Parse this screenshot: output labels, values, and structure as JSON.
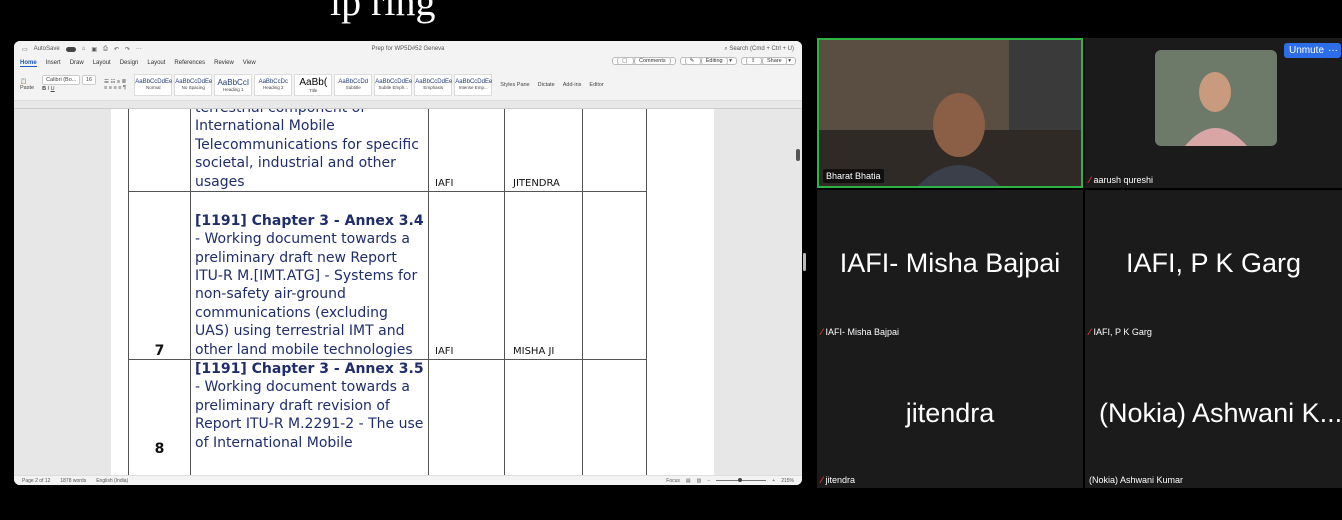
{
  "peek_text": "lp ring",
  "word": {
    "autosave_label": "AutoSave",
    "doc_title": "Prep for WP5D#52 Geneva",
    "search_placeholder": "Search (Cmd + Ctrl + U)",
    "tabs": [
      "Home",
      "Insert",
      "Draw",
      "Layout",
      "Design",
      "Layout",
      "References",
      "Review",
      "View"
    ],
    "buttons": {
      "comments": "Comments",
      "editing": "Editing",
      "share": "Share"
    },
    "font_name": "Calibri (Bo...",
    "font_size": "16",
    "paste_label": "Paste",
    "styles": [
      {
        "sample": "AaBbCcDdEe",
        "name": "Normal"
      },
      {
        "sample": "AaBbCcDdEe",
        "name": "No Spacing"
      },
      {
        "sample": "AaBbCcI",
        "name": "Heading 1"
      },
      {
        "sample": "AaBbCcDc",
        "name": "Heading 2"
      },
      {
        "sample": "AaBb(",
        "name": "Title"
      },
      {
        "sample": "AaBbCcDd",
        "name": "Subtitle"
      },
      {
        "sample": "AaBbCcDdEe",
        "name": "Subtle Emph..."
      },
      {
        "sample": "AaBbCcDdEe",
        "name": "Emphasis"
      },
      {
        "sample": "AaBbCcDdEe",
        "name": "Intense Emp..."
      }
    ],
    "ribbon_right": [
      "Styles Pane",
      "Dictate",
      "Add-ins",
      "Editor"
    ],
    "table_rows": [
      {
        "num": "",
        "title_bold": "",
        "text": "terrestrial component of International Mobile Telecommunications for specific societal, industrial and other usages",
        "org": "IAFI",
        "assignee": "JITENDRA"
      },
      {
        "num": "7",
        "title_bold": "[1191] Chapter 3 - Annex 3.4",
        "text": " - Working document towards a preliminary draft new Report ITU-R M.[IMT.ATG] - Systems for non-safety air-ground communications (excluding UAS) using terrestrial IMT and other land mobile technologies",
        "org": "IAFI",
        "assignee": "MISHA JI"
      },
      {
        "num": "8",
        "title_bold": "[1191] Chapter 3 - Annex 3.5",
        "text": " - Working document towards a preliminary draft revision of Report ITU-R M.2291-2 - The use of International Mobile",
        "org": "",
        "assignee": ""
      }
    ],
    "status": {
      "page": "Page 2 of 12",
      "words": "1878 words",
      "language": "English (India)",
      "focus": "Focus",
      "zoom": "215%"
    }
  },
  "meeting": {
    "unmute_label": "Unmute",
    "more_label": "···",
    "participants": [
      {
        "name": "Bharat Bhatia",
        "big": "",
        "muted": false,
        "video": true
      },
      {
        "name": "aarush qureshi",
        "big": "",
        "muted": true,
        "video": true
      },
      {
        "name": "IAFI- Misha Bajpai",
        "big": "IAFI- Misha Bajpai",
        "muted": true,
        "video": false
      },
      {
        "name": "IAFI, P K Garg",
        "big": "IAFI, P K Garg",
        "muted": true,
        "video": false
      },
      {
        "name": "jitendra",
        "big": "jitendra",
        "muted": true,
        "video": false
      },
      {
        "name": "(Nokia) Ashwani Kumar",
        "big": "(Nokia) Ashwani K...",
        "muted": false,
        "video": false
      }
    ]
  }
}
